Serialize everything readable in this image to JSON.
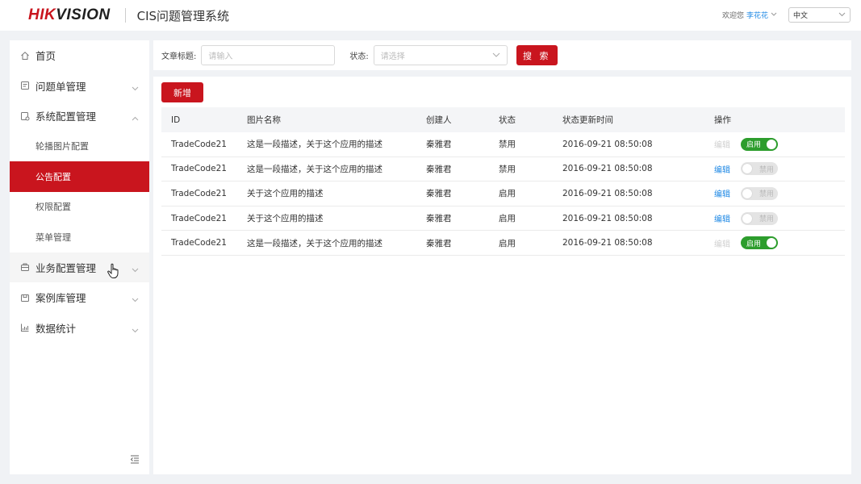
{
  "header": {
    "logo_part1": "HIK",
    "logo_part2": "VISION",
    "app_title": "CIS问题管理系统",
    "welcome": "欢迎您",
    "username": "李花花",
    "language": "中文"
  },
  "sidebar": {
    "items": [
      {
        "label": "首页",
        "icon": "home-icon"
      },
      {
        "label": "问题单管理",
        "icon": "document-icon"
      },
      {
        "label": "系统配置管理",
        "icon": "settings-document-icon"
      },
      {
        "label": "业务配置管理",
        "icon": "briefcase-icon"
      },
      {
        "label": "案例库管理",
        "icon": "case-library-icon"
      },
      {
        "label": "数据统计",
        "icon": "chart-icon"
      }
    ],
    "sub_items": [
      {
        "label": "轮播图片配置"
      },
      {
        "label": "公告配置"
      },
      {
        "label": "权限配置"
      },
      {
        "label": "菜单管理"
      }
    ]
  },
  "filter": {
    "title_label": "文章标题:",
    "title_placeholder": "请输入",
    "status_label": "状态:",
    "status_placeholder": "请选择",
    "search_label": "搜 索"
  },
  "table": {
    "add_label": "新增",
    "columns": [
      "ID",
      "图片名称",
      "创建人",
      "状态",
      "状态更新时间",
      "操作"
    ],
    "rows": [
      {
        "id": "TradeCode21",
        "name": "这是一段描述，关于这个应用的描述",
        "creator": "秦雅君",
        "status": "禁用",
        "time": "2016-09-21  08:50:08",
        "edit": "编辑",
        "toggle": "启用",
        "enabled": true
      },
      {
        "id": "TradeCode21",
        "name": "这是一段描述，关于这个应用的描述",
        "creator": "秦雅君",
        "status": "禁用",
        "time": "2016-09-21  08:50:08",
        "edit": "编辑",
        "toggle": "禁用",
        "enabled": false
      },
      {
        "id": "TradeCode21",
        "name": "关于这个应用的描述",
        "creator": "秦雅君",
        "status": "启用",
        "time": "2016-09-21  08:50:08",
        "edit": "编辑",
        "toggle": "禁用",
        "enabled": false
      },
      {
        "id": "TradeCode21",
        "name": "关于这个应用的描述",
        "creator": "秦雅君",
        "status": "启用",
        "time": "2016-09-21  08:50:08",
        "edit": "编辑",
        "toggle": "禁用",
        "enabled": false
      },
      {
        "id": "TradeCode21",
        "name": "这是一段描述，关于这个应用的描述",
        "creator": "秦雅君",
        "status": "启用",
        "time": "2016-09-21  08:50:08",
        "edit": "编辑",
        "toggle": "启用",
        "enabled": true
      }
    ]
  },
  "colors": {
    "brand_red": "#c9151e",
    "toggle_on": "#2d9d2d",
    "link_blue": "#1e88e5"
  }
}
